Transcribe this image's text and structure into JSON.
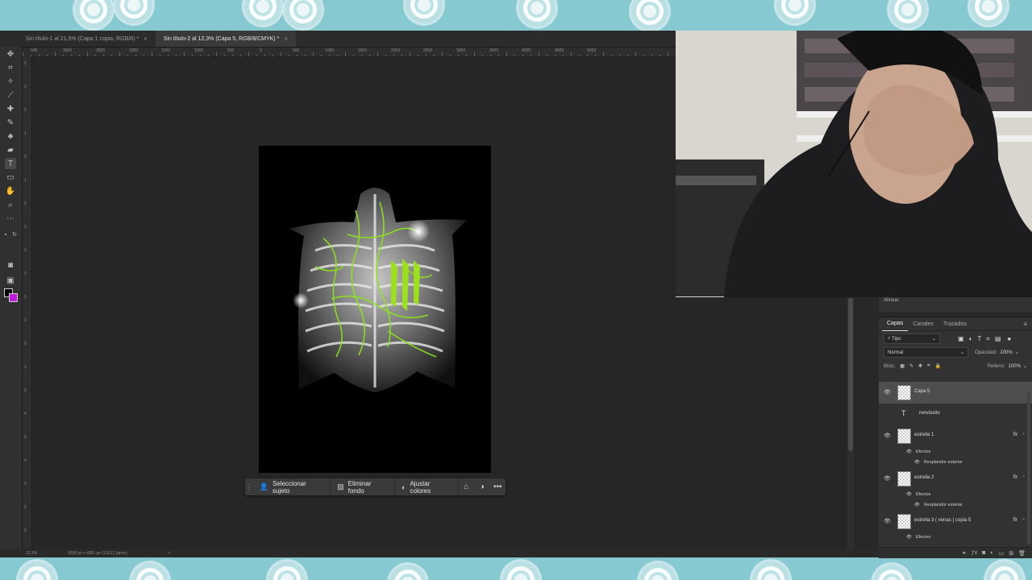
{
  "tabs": [
    {
      "label": "Sin título-1 al 21,5% (Capa 1 copia, RGB/8) *",
      "close": "×"
    },
    {
      "label": "Sin título-2 al 12,3% (Capa 5, RGB/8/CMYK) *",
      "close": "×"
    }
  ],
  "ruler": {
    "h_labels": [
      "500",
      "3000",
      "2500",
      "2000",
      "1500",
      "1000",
      "500",
      "0",
      "500",
      "1000",
      "1500",
      "2000",
      "2500",
      "3000",
      "3500",
      "4000",
      "4500",
      "5000"
    ],
    "v_labels": [
      "5",
      "0",
      "5",
      "1",
      "0",
      "1",
      "5",
      "2",
      "0",
      "2",
      "5",
      "3",
      "0",
      "3",
      "5",
      "4",
      "0",
      "4",
      "5",
      "5",
      "0"
    ]
  },
  "context_bar": {
    "select_subject": "Seleccionar sujeto",
    "remove_background": "Eliminar fondo",
    "adjust_colors": "Ajustar colores",
    "more": "•••"
  },
  "status": {
    "zoom": "12,3%",
    "doc_info": "3508 px x 4961 px (118,11 ppcm)",
    "arrow": ">"
  },
  "align_panel": {
    "title": "Alinear"
  },
  "layers_panel": {
    "tabs": [
      "Capas",
      "Canales",
      "Trazados"
    ],
    "kind_filter": "Tipo",
    "blend_mode": "Normal",
    "opacity_label": "Opacidad:",
    "opacity_value": "100%",
    "lock_label": "Bloq.:",
    "fill_label": "Relleno:",
    "fill_value": "100%",
    "layers": [
      {
        "name": "Capa 5"
      },
      {
        "name": "nerviosito"
      },
      {
        "name": "estrella 1",
        "effects_label": "Efectos",
        "effect": "Resplandor exterior"
      },
      {
        "name": "estrella 2",
        "effects_label": "Efectos",
        "effect": "Resplandor exterior"
      },
      {
        "name": "estrella 3 ( venas ) copia 5",
        "effects_label": "Efectos"
      }
    ],
    "fx_label": "fx"
  },
  "colors": {
    "foreground": "#000000",
    "background": "#c11be0",
    "accent_green": "#8be21a"
  }
}
